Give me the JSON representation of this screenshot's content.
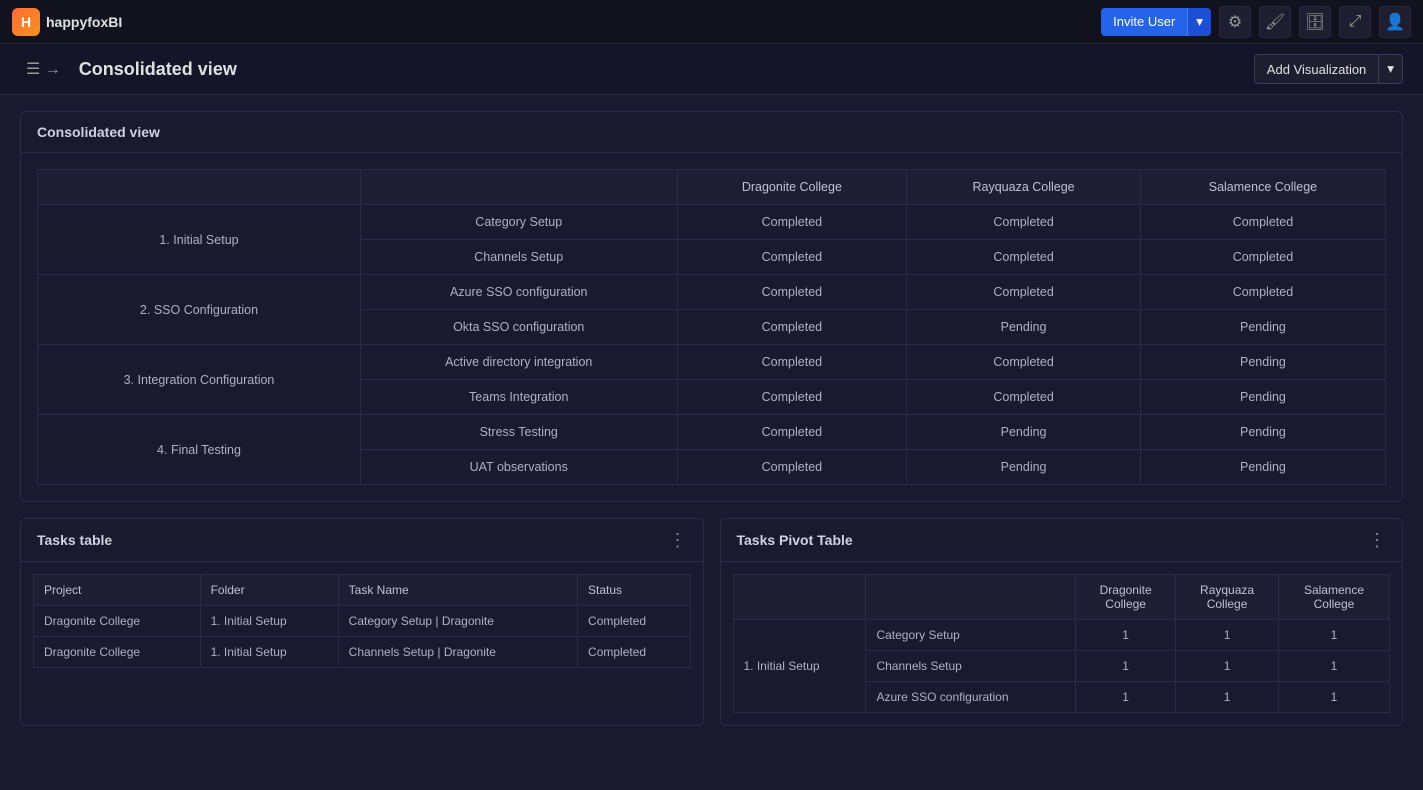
{
  "app": {
    "name": "happyfoxBI",
    "logo_letter": "H"
  },
  "topnav": {
    "invite_user_label": "Invite User",
    "icons": {
      "settings": "⚙",
      "brush": "🖌",
      "database": "🗄",
      "expand": "⤢",
      "user": "👤"
    }
  },
  "header": {
    "page_title": "Consolidated view",
    "add_visualization_label": "Add Visualization",
    "sidebar_toggle": "☰"
  },
  "consolidated_widget": {
    "title": "Consolidated view",
    "col_headers": [
      "",
      "",
      "Dragonite College",
      "Rayquaza College",
      "Salamence College"
    ],
    "rows": [
      {
        "group": "1. Initial Setup",
        "items": [
          {
            "task": "Category Setup",
            "dragonite": "Completed",
            "rayquaza": "Completed",
            "salamence": "Completed"
          },
          {
            "task": "Channels Setup",
            "dragonite": "Completed",
            "rayquaza": "Completed",
            "salamence": "Completed"
          }
        ]
      },
      {
        "group": "2. SSO Configuration",
        "items": [
          {
            "task": "Azure SSO configuration",
            "dragonite": "Completed",
            "rayquaza": "Completed",
            "salamence": "Completed"
          },
          {
            "task": "Okta SSO configuration",
            "dragonite": "Completed",
            "rayquaza": "Pending",
            "salamence": "Pending"
          }
        ]
      },
      {
        "group": "3. Integration Configuration",
        "items": [
          {
            "task": "Active directory integration",
            "dragonite": "Completed",
            "rayquaza": "Completed",
            "salamence": "Pending"
          },
          {
            "task": "Teams Integration",
            "dragonite": "Completed",
            "rayquaza": "Completed",
            "salamence": "Pending"
          }
        ]
      },
      {
        "group": "4. Final Testing",
        "items": [
          {
            "task": "Stress Testing",
            "dragonite": "Completed",
            "rayquaza": "Pending",
            "salamence": "Pending"
          },
          {
            "task": "UAT observations",
            "dragonite": "Completed",
            "rayquaza": "Pending",
            "salamence": "Pending"
          }
        ]
      }
    ]
  },
  "tasks_table_widget": {
    "title": "Tasks table",
    "col_headers": [
      "Project",
      "Folder",
      "Task Name",
      "Status"
    ],
    "rows": [
      {
        "project": "Dragonite College",
        "folder": "1. Initial Setup",
        "task_name": "Category Setup | Dragonite",
        "status": "Completed"
      },
      {
        "project": "Dragonite College",
        "folder": "1. Initial Setup",
        "task_name": "Channels Setup | Dragonite",
        "status": "Completed"
      }
    ]
  },
  "pivot_table_widget": {
    "title": "Tasks Pivot Table",
    "col_headers": [
      "",
      "",
      "Dragonite College",
      "Rayquaza College",
      "Salamence College"
    ],
    "rows": [
      {
        "group": "1. Initial Setup",
        "items": [
          {
            "task": "Category Setup",
            "dragonite": "1",
            "rayquaza": "1",
            "salamence": "1"
          },
          {
            "task": "Channels Setup",
            "dragonite": "1",
            "rayquaza": "1",
            "salamence": "1"
          },
          {
            "task": "Azure SSO configuration",
            "dragonite": "1",
            "rayquaza": "1",
            "salamence": "1"
          }
        ]
      }
    ]
  }
}
